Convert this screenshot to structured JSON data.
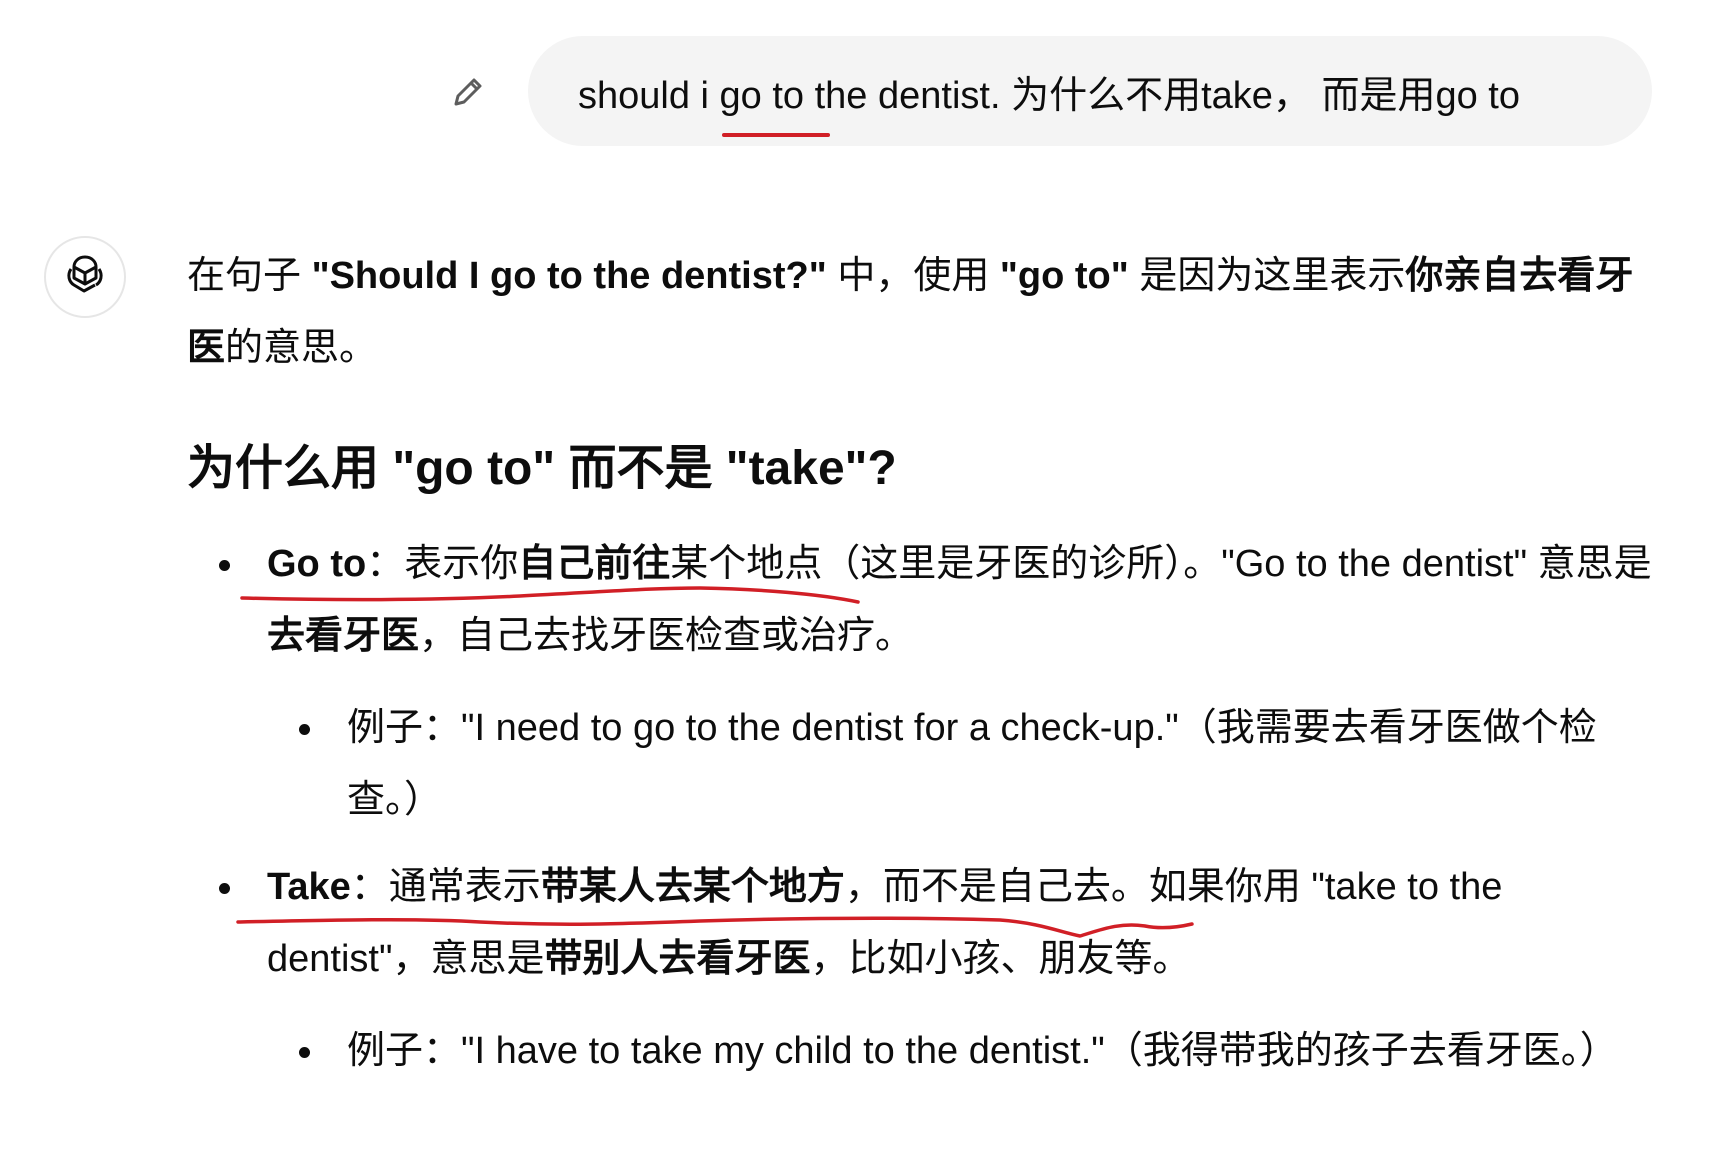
{
  "user_message": {
    "text": "should i go to the dentist. 为什么不用take，  而是用go to",
    "edit_icon": "pencil-icon"
  },
  "assistant": {
    "avatar_icon": "openai-logo-icon",
    "intro": {
      "p1": "在句子 ",
      "b1": "\"Should I go to the dentist?\"",
      "p2": " 中，使用 ",
      "b2": "\"go to\"",
      "p3": " 是因为这里表示",
      "b3": "你亲自去看牙医",
      "p4": "的意思。"
    },
    "heading": "为什么用 \"go to\" 而不是 \"take\"?",
    "bullets": [
      {
        "term": "Go to",
        "sep": "：表示你",
        "b1": "自己前往",
        "t1": "某个地点（这里是牙医的诊所）。\"Go to the dentist\" 意思是",
        "b2": "去看牙医",
        "t2": "，自己去找牙医检查或治疗。",
        "example": "例子：\"I need to go to the dentist for a check-up.\"（我需要去看牙医做个检查。）"
      },
      {
        "term": "Take",
        "sep": "：通常表示",
        "b1": "带某人去某个地方",
        "t1": "，而不是自己去。如果你用 \"take to the dentist\"，意思是",
        "b2": "带别人去看牙医",
        "t2": "，比如小孩、朋友等。",
        "example": "例子：\"I have to take my child to the dentist.\"（我得带我的孩子去看牙医。）"
      }
    ]
  },
  "annotation_color": "#d11f26"
}
